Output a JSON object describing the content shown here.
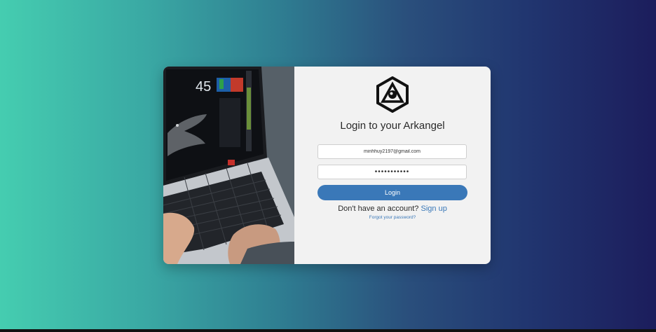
{
  "login": {
    "title": "Login to your Arkangel",
    "email_value": "minhhuy2197@gmail.com",
    "password_value": "•••••••••••",
    "button_label": "Login",
    "no_account_text": "Don't have an account?",
    "signup_label": "Sign up",
    "forgot_label": "Forgot your password?"
  },
  "hero": {
    "screen_number": "45"
  },
  "colors": {
    "accent": "#3a78b8",
    "card_background": "#f2f2f2",
    "gradient_left": "#45cdb0",
    "gradient_right": "#1c1d5c"
  },
  "icons": {
    "logo": "arkangel-logo-icon"
  }
}
